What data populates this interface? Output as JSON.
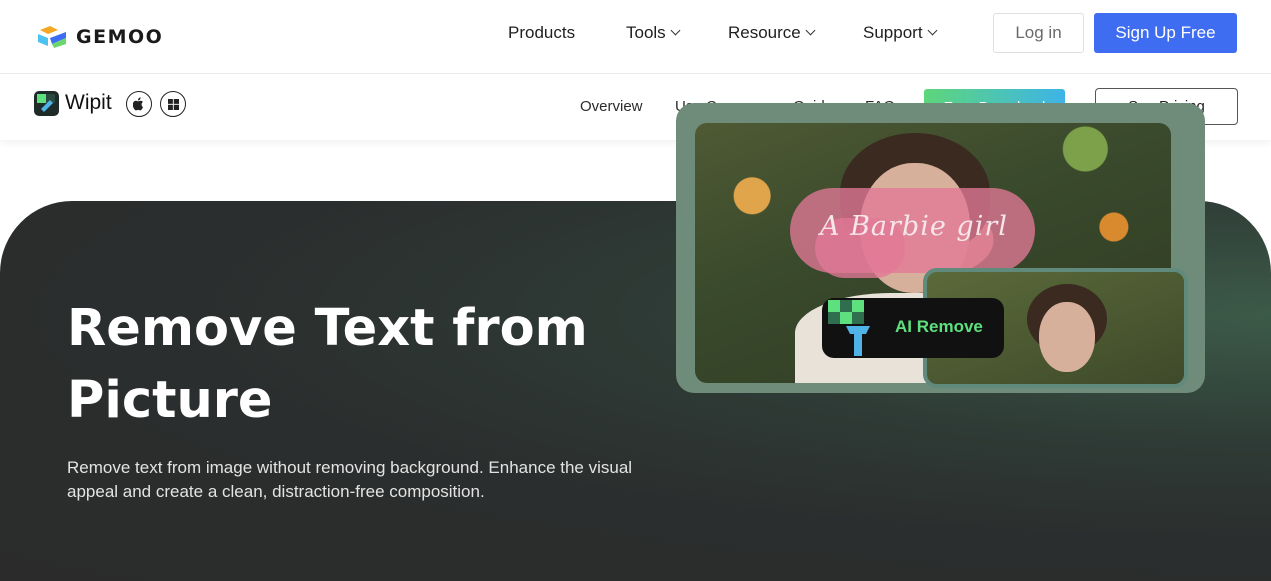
{
  "brand": {
    "name": "GEMOO"
  },
  "topnav": {
    "items": [
      {
        "label": "Products",
        "has_dropdown": false
      },
      {
        "label": "Tools",
        "has_dropdown": true
      },
      {
        "label": "Resource",
        "has_dropdown": true
      },
      {
        "label": "Support",
        "has_dropdown": true
      }
    ],
    "login_label": "Log in",
    "signup_label": "Sign Up Free"
  },
  "subnav": {
    "product_name": "Wipit",
    "os_icons": [
      "apple-icon",
      "windows-icon"
    ],
    "links": [
      {
        "label": "Overview",
        "has_dropdown": false
      },
      {
        "label": "Use Cases",
        "has_dropdown": true
      },
      {
        "label": "Guide",
        "has_dropdown": false
      },
      {
        "label": "FAQ",
        "has_dropdown": false
      }
    ],
    "download_label": "Free Download",
    "pricing_label": "See Pricing"
  },
  "hero": {
    "title_line1": "Remove Text from",
    "title_line2": "Picture",
    "description": "Remove text from image without removing background. Enhance the visual appeal and create a clean, distraction-free composition.",
    "image_overlay_text": "A Barbie girl",
    "badge_label": "AI Remove"
  },
  "colors": {
    "accent_blue": "#3f6df2",
    "download_gradient_start": "#5ed67a",
    "download_gradient_end": "#3db4e8",
    "hero_bg": "#2b2b2b",
    "badge_text": "#5ee07e"
  }
}
